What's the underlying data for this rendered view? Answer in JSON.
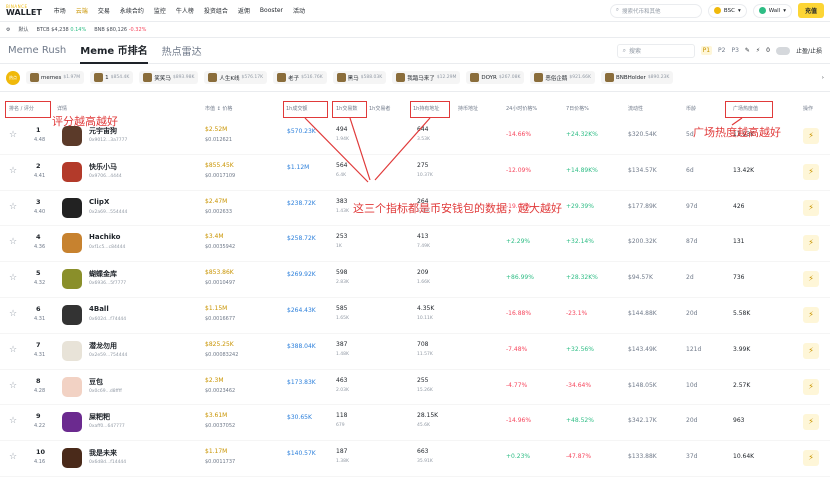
{
  "topnav": {
    "logo_top": "BINANCE",
    "logo_bottom": "WALLET",
    "items": [
      "市场",
      "云端",
      "交易",
      "永续合约",
      "监控",
      "牛人榜",
      "投资组合",
      "返佣",
      "Booster",
      "活动"
    ],
    "search_placeholder": "搜索代币和其他",
    "chain": "BSC",
    "wallet": "Wall",
    "charge": "充值"
  },
  "ticker": [
    {
      "label": "BTCB",
      "price": "$4,238",
      "chg": "0.14%"
    },
    {
      "label": "BNB",
      "price": "$80,126",
      "chg": "-0.32%"
    }
  ],
  "ticker_default": "默认",
  "tabs": [
    "Meme Rush",
    "Meme 币排名",
    "热点雷达"
  ],
  "controls": {
    "search": "搜索",
    "p1": "P1",
    "p2": "P2",
    "p3": "P3",
    "count": "0",
    "stop": "止盈/止损"
  },
  "hotstrip": {
    "badge": "热点",
    "items": [
      {
        "name": "memes",
        "value": "$1.97M"
      },
      {
        "name": "1",
        "value": "$854.4K"
      },
      {
        "name": "笑笑马",
        "value": "$893.98K"
      },
      {
        "name": "人生K线",
        "value": "$576.17K"
      },
      {
        "name": "老子",
        "value": "$516.76K"
      },
      {
        "name": "黑马",
        "value": "$588.03K"
      },
      {
        "name": "我踏马来了",
        "value": "$12.29M"
      },
      {
        "name": "DOYR",
        "value": "$267.08K"
      },
      {
        "name": "恶俗企鹅",
        "value": "$921.66K"
      },
      {
        "name": "BNBHolder",
        "value": "$890.23K"
      }
    ]
  },
  "headers": {
    "rank": "排名 / 评分",
    "detail": "详情",
    "mcap": "市值 ↕ 价格",
    "vol": "1h成交额",
    "txn": "1h交易数",
    "traders": "1h交易者",
    "holders": "1h持有地址",
    "holder_addr": "持币地址",
    "chg24": "24小时价格%",
    "chg7": "7日价格%",
    "liq": "流动性",
    "age": "币龄",
    "heat": "广场热度值",
    "op": "操作"
  },
  "rows": [
    {
      "rank": "1",
      "score": "4.48",
      "name": "元宇宙狗",
      "addr": "0x9012...3a7777",
      "mcap": "$2.52M",
      "price": "$0.012621",
      "vol": "$570.23K",
      "tx": "494",
      "txs": "1.94K",
      "hold": "644",
      "holds": "3.53K",
      "c24": "-14.66%",
      "c7": "+24.32K%",
      "liq": "$320.54K",
      "age": "5d",
      "heat": "13.93K",
      "color": "#5b3a29"
    },
    {
      "rank": "2",
      "score": "4.41",
      "name": "快乐小马",
      "addr": "0x9706...4444",
      "mcap": "$855.45K",
      "price": "$0.0017109",
      "vol": "$1.12M",
      "tx": "564",
      "txs": "6.4K",
      "hold": "275",
      "holds": "10.37K",
      "c24": "-12.09%",
      "c7": "+14.89K%",
      "liq": "$134.57K",
      "age": "6d",
      "heat": "13.42K",
      "color": "#b33a2a"
    },
    {
      "rank": "3",
      "score": "4.40",
      "name": "ClipX",
      "addr": "0x2a69...554444",
      "mcap": "$2.47M",
      "price": "$0.002633",
      "vol": "$238.72K",
      "tx": "383",
      "txs": "1.43K",
      "hold": "264",
      "holds": "5.36K",
      "c24": "-19.07%",
      "c7": "+29.39%",
      "liq": "$177.89K",
      "age": "97d",
      "heat": "426",
      "color": "#222"
    },
    {
      "rank": "4",
      "score": "4.36",
      "name": "Hachiko",
      "addr": "0xf1c5...c84444",
      "mcap": "$3.4M",
      "price": "$0.0035942",
      "vol": "$258.72K",
      "tx": "253",
      "txs": "1K",
      "hold": "413",
      "holds": "7.49K",
      "c24": "+2.29%",
      "c7": "+32.14%",
      "liq": "$200.32K",
      "age": "87d",
      "heat": "131",
      "color": "#c7822f"
    },
    {
      "rank": "5",
      "score": "4.32",
      "name": "蝴蝶金库",
      "addr": "0x6936...5f7777",
      "mcap": "$853.86K",
      "price": "$0.0010497",
      "vol": "$269.92K",
      "tx": "598",
      "txs": "2.83K",
      "hold": "209",
      "holds": "1.66K",
      "c24": "+86.99%",
      "c7": "+28.32K%",
      "liq": "$94.57K",
      "age": "2d",
      "heat": "736",
      "color": "#8a8f2a"
    },
    {
      "rank": "6",
      "score": "4.31",
      "name": "4Ball",
      "addr": "0x602d...f74444",
      "mcap": "$1.15M",
      "price": "$0.0016677",
      "vol": "$264.43K",
      "tx": "585",
      "txs": "1.65K",
      "hold": "4.35K",
      "holds": "10.11K",
      "c24": "-16.88%",
      "c7": "-23.1%",
      "liq": "$144.88K",
      "age": "20d",
      "heat": "5.58K",
      "color": "#333"
    },
    {
      "rank": "7",
      "score": "4.31",
      "name": "潜龙勿用",
      "addr": "0x2e59...754444",
      "mcap": "$825.25K",
      "price": "$0.00083242",
      "vol": "$388.04K",
      "tx": "387",
      "txs": "1.48K",
      "hold": "708",
      "holds": "11.57K",
      "c24": "-7.48%",
      "c7": "+32.56%",
      "liq": "$143.49K",
      "age": "121d",
      "heat": "3.99K",
      "color": "#e8e3d8"
    },
    {
      "rank": "8",
      "score": "4.28",
      "name": "豆包",
      "addr": "0x0c69...d8ffff",
      "mcap": "$2.3M",
      "price": "$0.0023462",
      "vol": "$173.83K",
      "tx": "463",
      "txs": "2.03K",
      "hold": "255",
      "holds": "15.26K",
      "c24": "-4.77%",
      "c7": "-34.64%",
      "liq": "$148.05K",
      "age": "10d",
      "heat": "2.57K",
      "color": "#f2d2c4"
    },
    {
      "rank": "9",
      "score": "4.22",
      "name": "屎粑粑",
      "addr": "0xaff0...647777",
      "mcap": "$3.61M",
      "price": "$0.0037052",
      "vol": "$30.65K",
      "tx": "118",
      "txs": "679",
      "hold": "28.15K",
      "holds": "45.6K",
      "c24": "-14.96%",
      "c7": "+48.52%",
      "liq": "$342.17K",
      "age": "20d",
      "heat": "963",
      "color": "#6b2a8f"
    },
    {
      "rank": "10",
      "score": "4.16",
      "name": "我是未来",
      "addr": "0x6d8d...f14444",
      "mcap": "$1.17M",
      "price": "$0.0011737",
      "vol": "$140.57K",
      "tx": "187",
      "txs": "1.38K",
      "hold": "663",
      "holds": "35.91K",
      "c24": "+0.23%",
      "c7": "-47.87%",
      "liq": "$133.88K",
      "age": "37d",
      "heat": "10.64K",
      "color": "#4a2a1a"
    }
  ],
  "annotations": {
    "left": "评分越高越好",
    "right": "广场热度越高越好",
    "center": "这三个指标都是币安钱包的数据，越大越好"
  }
}
